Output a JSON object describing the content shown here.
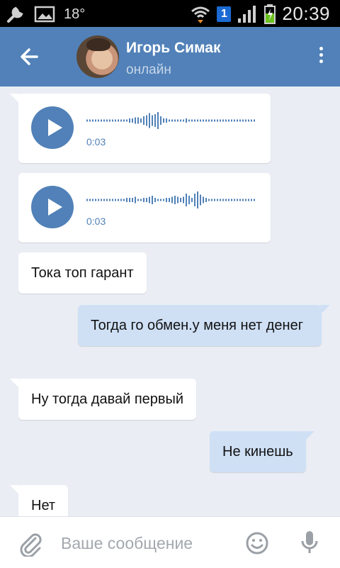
{
  "status_bar": {
    "temperature": "18°",
    "notification_count": "1",
    "time": "20:39",
    "icons": [
      "wrench-icon",
      "image-icon",
      "wifi-icon",
      "signal-icon",
      "battery-icon"
    ]
  },
  "header": {
    "name": "Игорь Симак",
    "status": "онлайн",
    "back_icon": "arrow-left-icon",
    "menu_icon": "more-vertical-icon",
    "background_color": "#5181b8"
  },
  "messages": [
    {
      "type": "voice",
      "direction": "in",
      "duration": "0:03"
    },
    {
      "type": "voice",
      "direction": "in",
      "duration": "0:03"
    },
    {
      "type": "text",
      "direction": "in",
      "text": "Тока топ гарант"
    },
    {
      "type": "text",
      "direction": "out",
      "text": "Тогда го обмен.у меня нет денег"
    },
    {
      "type": "text",
      "direction": "in",
      "text": "Ну тогда давай первый"
    },
    {
      "type": "text",
      "direction": "out",
      "text": "Не кинешь"
    },
    {
      "type": "text",
      "direction": "in",
      "text": "Нет"
    }
  ],
  "input_bar": {
    "placeholder": "Ваше сообщение",
    "icons": [
      "paperclip-icon",
      "smile-icon",
      "microphone-icon"
    ]
  }
}
